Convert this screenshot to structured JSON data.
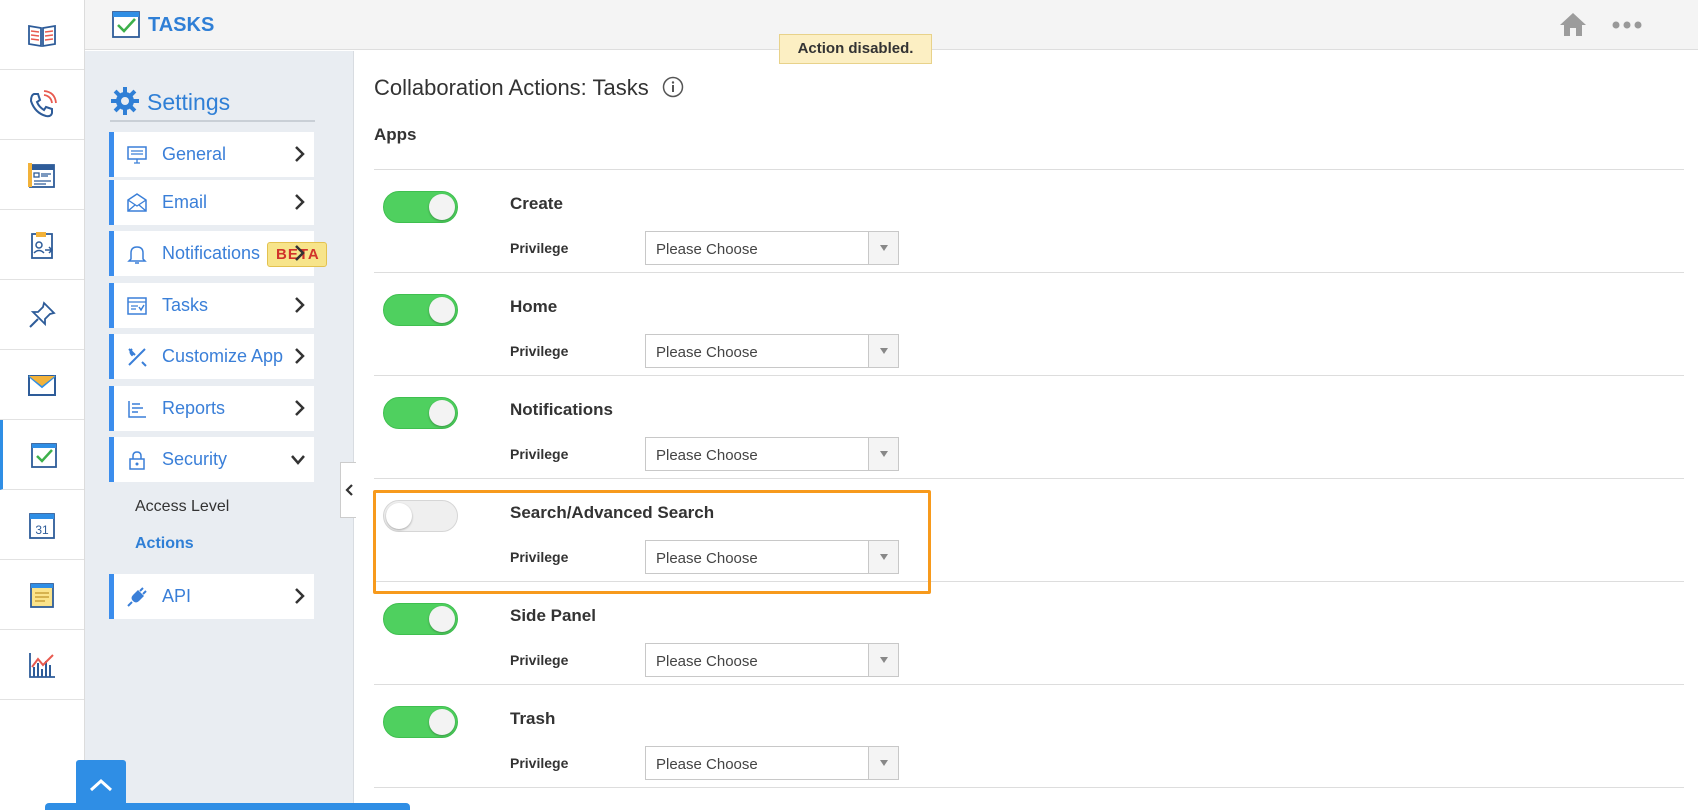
{
  "app": {
    "title": "TASKS"
  },
  "toast": "Action disabled.",
  "rail": [
    "book-icon",
    "phone-icon",
    "contacts-icon",
    "transfer-icon",
    "pin-icon",
    "mail-icon",
    "tasks-icon",
    "calendar-icon",
    "notes-icon",
    "analytics-icon"
  ],
  "calendar_day": "31",
  "settings": {
    "title": "Settings",
    "nav": [
      {
        "label": "General",
        "icon": "monitor-icon"
      },
      {
        "label": "Email",
        "icon": "envelope-icon"
      },
      {
        "label": "Notifications",
        "icon": "bell-icon",
        "badge": "BETA"
      },
      {
        "label": "Tasks",
        "icon": "tasks-list-icon"
      },
      {
        "label": "Customize App",
        "icon": "tools-icon"
      },
      {
        "label": "Reports",
        "icon": "report-icon"
      },
      {
        "label": "Security",
        "icon": "lock-icon",
        "expanded": true
      },
      {
        "label": "API",
        "icon": "plug-icon"
      }
    ],
    "security_sub": [
      "Access Level",
      "Actions"
    ],
    "active_sub": "Actions"
  },
  "main": {
    "title": "Collaboration Actions: Tasks",
    "section": "Apps",
    "privilege_label": "Privilege",
    "rows": [
      {
        "title": "Create",
        "enabled": true,
        "privilege": "Please Choose"
      },
      {
        "title": "Home",
        "enabled": true,
        "privilege": "Please Choose"
      },
      {
        "title": "Notifications",
        "enabled": true,
        "privilege": "Please Choose"
      },
      {
        "title": "Search/Advanced Search",
        "enabled": false,
        "privilege": "Please Choose"
      },
      {
        "title": "Side Panel",
        "enabled": true,
        "privilege": "Please Choose"
      },
      {
        "title": "Trash",
        "enabled": true,
        "privilege": "Please Choose"
      }
    ]
  },
  "colors": {
    "accent": "#2f7fd6",
    "toggle_on": "#4fd05f",
    "highlight": "#f79a1c",
    "toast_bg": "#fcefc3"
  }
}
